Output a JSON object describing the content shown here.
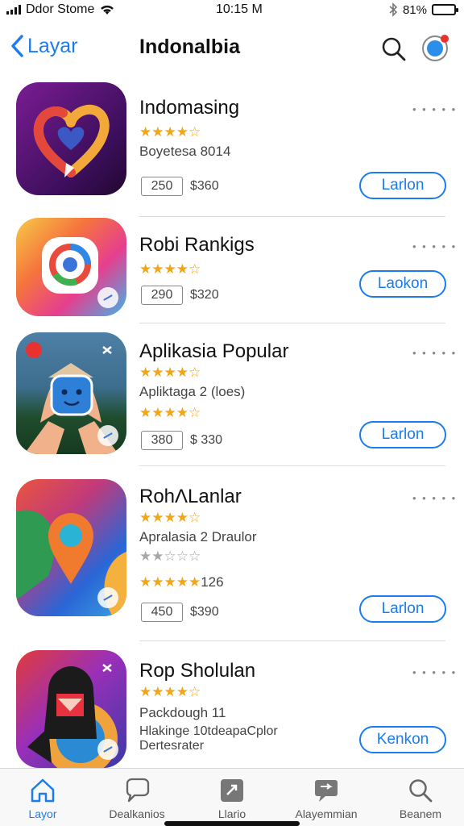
{
  "status_bar": {
    "carrier": "Ddor Stome",
    "time": "10:15 M",
    "battery_text": "81%",
    "battery_level": 0.81
  },
  "nav": {
    "back_label": "Layar",
    "title": "Indonalbia"
  },
  "apps": [
    {
      "name": "Indomasing",
      "stars": "★★★★☆",
      "subtitle": "Boyetesa 8014",
      "size": "250",
      "price": "$360",
      "button": "Larlon",
      "more": "• • • • •"
    },
    {
      "name": "Robi Rankigs",
      "stars": "★★★★☆",
      "size": "290",
      "price": "$320",
      "button": "Laokon",
      "more": "• • • • •"
    },
    {
      "name": "Aplikasia Popular",
      "stars": "★★★★☆",
      "subtitle": "Apliktaga 2 (loes)",
      "stars2": "★★★★☆",
      "size": "380",
      "price": "$ 330",
      "button": "Larlon",
      "more": "• • • • •"
    },
    {
      "name": "RohΛLanlar",
      "stars": "★★★★☆",
      "subtitle": "Apralasia 2 Draulor",
      "stars_grey": "★★☆☆☆",
      "stars3": "★★★★★",
      "rating_count": "126",
      "size": "450",
      "price": "$390",
      "button": "Larlon",
      "more": "• • • • •"
    },
    {
      "name": "Rop Sholulan",
      "stars": "★★★★☆",
      "subtitle": "Packdough 11",
      "desc1": "Hlakinge 10tdeapaCplor",
      "desc2": "Dertesrater",
      "button": "Kenkon",
      "more": "• • • • •"
    }
  ],
  "tabs": [
    {
      "label": "Layor",
      "icon": "home-icon"
    },
    {
      "label": "Dealkanios",
      "icon": "chat-icon"
    },
    {
      "label": "Llario",
      "icon": "games-icon"
    },
    {
      "label": "Alayemmian",
      "icon": "message-icon"
    },
    {
      "label": "Beanem",
      "icon": "search-icon"
    }
  ],
  "colors": {
    "accent": "#1a7cf0",
    "star": "#f2a516"
  }
}
